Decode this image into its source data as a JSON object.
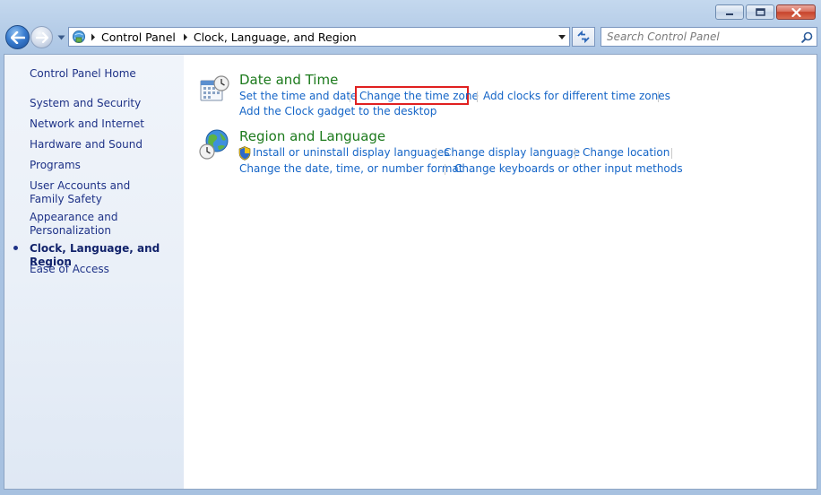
{
  "window": {
    "caption": {
      "minimize": "minimize",
      "maximize": "maximize",
      "close": "close"
    }
  },
  "navigation": {
    "breadcrumbs": [
      "Control Panel",
      "Clock, Language, and Region"
    ],
    "search_placeholder": "Search Control Panel"
  },
  "sidebar": {
    "home": "Control Panel Home",
    "items": [
      {
        "label": "System and Security"
      },
      {
        "label": "Network and Internet"
      },
      {
        "label": "Hardware and Sound"
      },
      {
        "label": "Programs"
      },
      {
        "label": "User Accounts and Family Safety"
      },
      {
        "label": "Appearance and Personalization"
      },
      {
        "label": "Clock, Language, and Region",
        "current": true
      },
      {
        "label": "Ease of Access"
      }
    ]
  },
  "categories": {
    "date_time": {
      "title": "Date and Time",
      "icon": "calendar-clock-icon",
      "links": [
        "Set the time and date",
        "Change the time zone",
        "Add clocks for different time zones",
        "Add the Clock gadget to the desktop"
      ],
      "highlighted_link": "Change the time zone"
    },
    "region_language": {
      "title": "Region and Language",
      "icon": "globe-clock-icon",
      "links": [
        "Install or uninstall display languages",
        "Change display language",
        "Change location",
        "Change the date, time, or number format",
        "Change keyboards or other input methods"
      ]
    }
  },
  "colors": {
    "link": "#1565c7",
    "category_title": "#1c7a1c",
    "highlight": "#e02020",
    "sidebar_link": "#1e3287"
  }
}
